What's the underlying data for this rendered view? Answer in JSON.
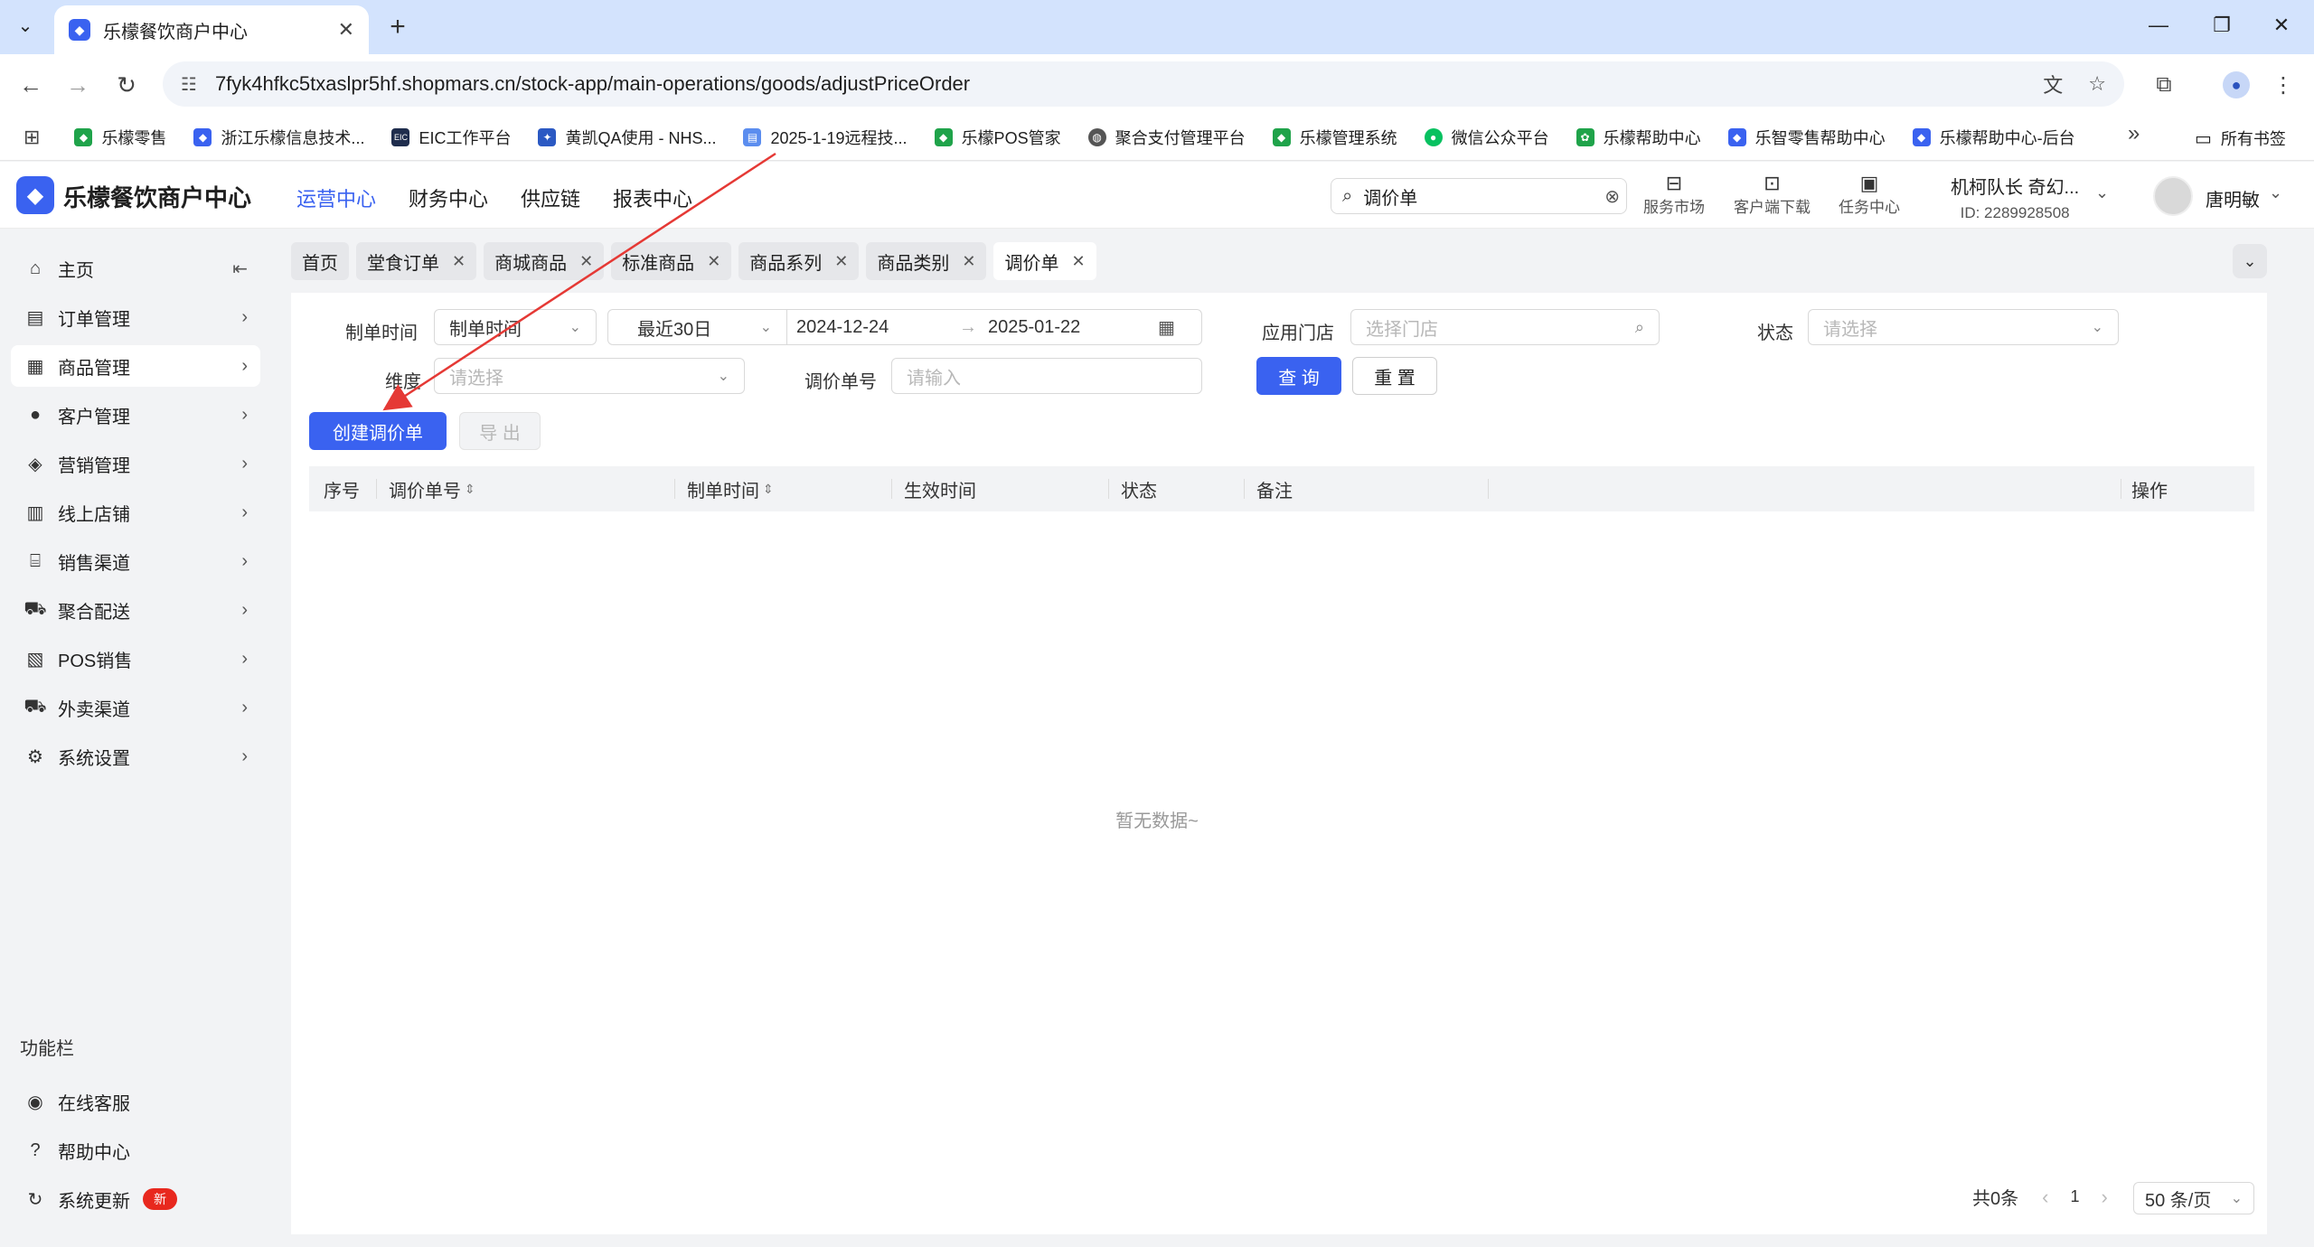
{
  "browser": {
    "tab_title": "乐檬餐饮商户中心",
    "url": "7fyk4hfkc5txaslpr5hf.shopmars.cn/stock-app/main-operations/goods/adjustPriceOrder",
    "bookmarks": [
      {
        "label": "乐檬零售",
        "color": "#1fa34a",
        "icon": "diamond-icon"
      },
      {
        "label": "浙江乐檬信息技术...",
        "color": "#3a62f0",
        "icon": "diamond-icon"
      },
      {
        "label": "EIC工作平台",
        "color": "#1f2d4d",
        "icon": "eic-icon"
      },
      {
        "label": "黄凯QA使用 - NHS...",
        "color": "#2b59c3",
        "icon": "jira-icon"
      },
      {
        "label": "2025-1-19远程技...",
        "color": "#5b8def",
        "icon": "doc-icon"
      },
      {
        "label": "乐檬POS管家",
        "color": "#1fa34a",
        "icon": "diamond-icon"
      },
      {
        "label": "聚合支付管理平台",
        "color": "#555555",
        "icon": "globe-icon"
      },
      {
        "label": "乐檬管理系统",
        "color": "#1fa34a",
        "icon": "diamond-icon"
      },
      {
        "label": "微信公众平台",
        "color": "#07c160",
        "icon": "wechat-icon"
      },
      {
        "label": "乐檬帮助中心",
        "color": "#1fa34a",
        "icon": "lemon-icon"
      },
      {
        "label": "乐智零售帮助中心",
        "color": "#3a62f0",
        "icon": "diamond-icon"
      },
      {
        "label": "乐檬帮助中心-后台",
        "color": "#3a62f0",
        "icon": "diamond-icon"
      }
    ],
    "all_bookmarks": "所有书签"
  },
  "app": {
    "brand": "乐檬餐饮商户中心",
    "topnav": [
      "运营中心",
      "财务中心",
      "供应链",
      "报表中心"
    ],
    "search_value": "调价单",
    "tools": [
      "服务市场",
      "客户端下载",
      "任务中心"
    ],
    "org_name": "机柯队长 奇幻...",
    "org_id": "ID: 2289928508",
    "username": "唐明敏"
  },
  "sidebar": {
    "items": [
      {
        "label": "主页",
        "icon": "home-icon"
      },
      {
        "label": "订单管理",
        "icon": "order-icon"
      },
      {
        "label": "商品管理",
        "icon": "goods-icon"
      },
      {
        "label": "客户管理",
        "icon": "user-icon"
      },
      {
        "label": "营销管理",
        "icon": "tag-icon"
      },
      {
        "label": "线上店铺",
        "icon": "store-icon"
      },
      {
        "label": "销售渠道",
        "icon": "bank-icon"
      },
      {
        "label": "聚合配送",
        "icon": "truck-icon"
      },
      {
        "label": "POS销售",
        "icon": "pos-icon"
      },
      {
        "label": "外卖渠道",
        "icon": "delivery-icon"
      },
      {
        "label": "系统设置",
        "icon": "gear-icon"
      }
    ],
    "section_title": "功能栏",
    "footer": [
      {
        "label": "在线客服",
        "icon": "support-icon"
      },
      {
        "label": "帮助中心",
        "icon": "help-icon"
      },
      {
        "label": "系统更新",
        "icon": "refresh-icon",
        "badge": "新"
      }
    ]
  },
  "pagetabs": [
    "首页",
    "堂食订单",
    "商城商品",
    "标准商品",
    "商品系列",
    "商品类别",
    "调价单"
  ],
  "filters": {
    "create_time_label": "制单时间",
    "create_time_type": "制单时间",
    "range_preset": "最近30日",
    "date_start": "2024-12-24",
    "date_end": "2025-01-22",
    "store_label": "应用门店",
    "store_placeholder": "选择门店",
    "status_label": "状态",
    "status_placeholder": "请选择",
    "dimension_label": "维度",
    "dimension_placeholder": "请选择",
    "order_no_label": "调价单号",
    "order_no_placeholder": "请输入",
    "query_btn": "查 询",
    "reset_btn": "重 置"
  },
  "actions": {
    "create_btn": "创建调价单",
    "export_btn": "导 出"
  },
  "table": {
    "columns": [
      "序号",
      "调价单号",
      "制单时间",
      "生效时间",
      "状态",
      "备注",
      "操作"
    ],
    "empty_text": "暂无数据~"
  },
  "pagination": {
    "total": "共0条",
    "page": "1",
    "page_size": "50 条/页"
  },
  "colors": {
    "accent": "#3a62f0",
    "annotation": "#e53935"
  }
}
